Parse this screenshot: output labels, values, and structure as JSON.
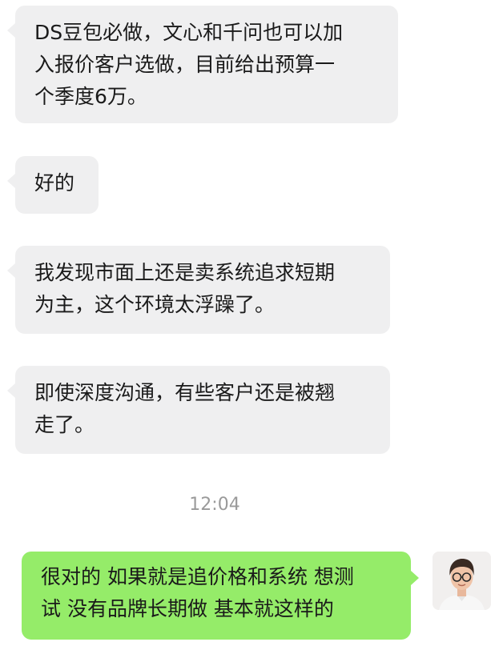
{
  "messages": [
    {
      "direction": "incoming",
      "text": "DS豆包必做，文心和千问也可以加\n入报价客户选做，目前给出预算一\n个季度6万。"
    },
    {
      "direction": "incoming",
      "text": "好的"
    },
    {
      "direction": "incoming",
      "text": "我发现市面上还是卖系统追求短期\n为主，这个环境太浮躁了。"
    },
    {
      "direction": "incoming",
      "text": "即使深度沟通，有些客户还是被翘\n走了。"
    },
    {
      "direction": "outgoing",
      "text": "很对的 如果就是追价格和系统 想测\n试 没有品牌长期做 基本就这样的"
    }
  ],
  "timestamp": "12:04",
  "avatar": {
    "icon": "user-avatar-photo"
  },
  "colors": {
    "incoming_bubble": "#efeff0",
    "outgoing_bubble": "#95ec69",
    "timestamp_text": "#9a9a9a"
  }
}
